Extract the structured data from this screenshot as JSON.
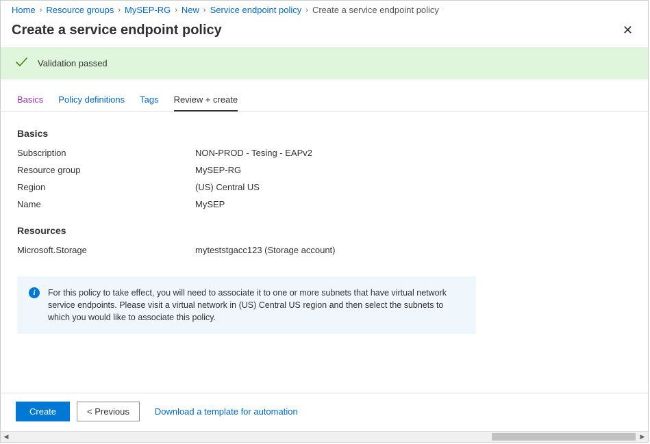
{
  "breadcrumb": {
    "items": [
      {
        "label": "Home"
      },
      {
        "label": "Resource groups"
      },
      {
        "label": "MySEP-RG"
      },
      {
        "label": "New"
      },
      {
        "label": "Service endpoint policy"
      }
    ],
    "current": "Create a service endpoint policy"
  },
  "page_title": "Create a service endpoint policy",
  "validation": {
    "message": "Validation passed"
  },
  "tabs": [
    {
      "label": "Basics"
    },
    {
      "label": "Policy definitions"
    },
    {
      "label": "Tags"
    },
    {
      "label": "Review + create"
    }
  ],
  "sections": {
    "basics": {
      "heading": "Basics",
      "rows": [
        {
          "k": "Subscription",
          "v": "NON-PROD - Tesing - EAPv2"
        },
        {
          "k": "Resource group",
          "v": "MySEP-RG"
        },
        {
          "k": "Region",
          "v": "(US) Central US"
        },
        {
          "k": "Name",
          "v": "MySEP"
        }
      ]
    },
    "resources": {
      "heading": "Resources",
      "rows": [
        {
          "k": "Microsoft.Storage",
          "v": "myteststgacc123 (Storage account)"
        }
      ]
    }
  },
  "infobox": {
    "text": "For this policy to take effect, you will need to associate it to one or more subnets that have virtual network service endpoints. Please visit a virtual network in (US) Central US region and then select the subnets to which you would like to associate this policy."
  },
  "footer": {
    "create_label": "Create",
    "previous_label": "< Previous",
    "download_label": "Download a template for automation"
  }
}
